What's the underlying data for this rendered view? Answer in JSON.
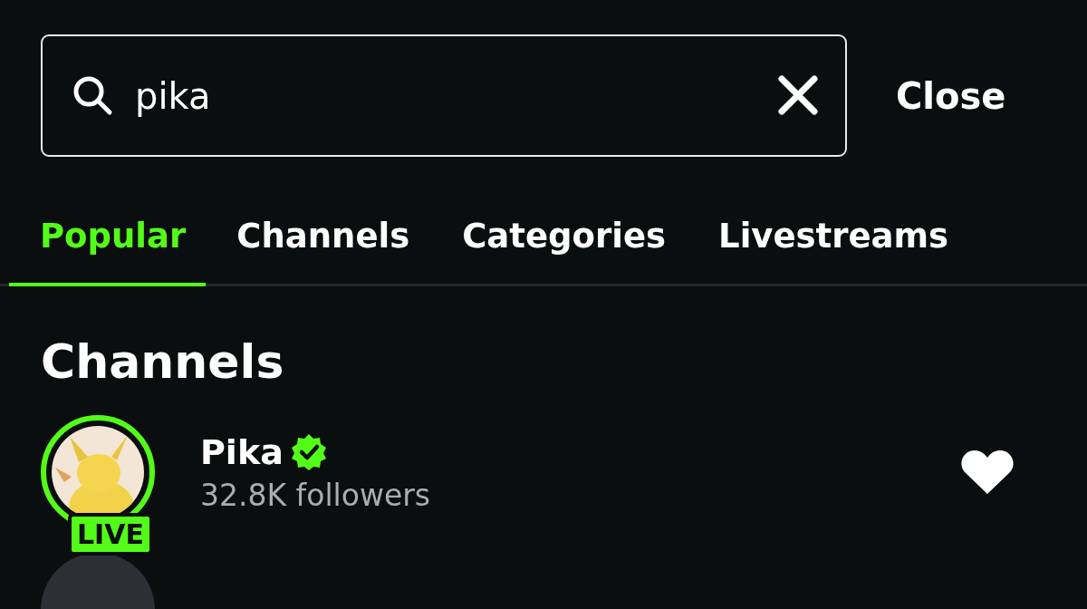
{
  "search": {
    "value": "pika",
    "close_label": "Close"
  },
  "tabs": [
    {
      "label": "Popular",
      "selected": true
    },
    {
      "label": "Channels",
      "selected": false
    },
    {
      "label": "Categories",
      "selected": false
    },
    {
      "label": "Livestreams",
      "selected": false
    }
  ],
  "section_title": "Channels",
  "channels": [
    {
      "name": "Pika",
      "verified": true,
      "followers": "32.8K followers",
      "live": true,
      "live_label": "LIVE"
    }
  ]
}
